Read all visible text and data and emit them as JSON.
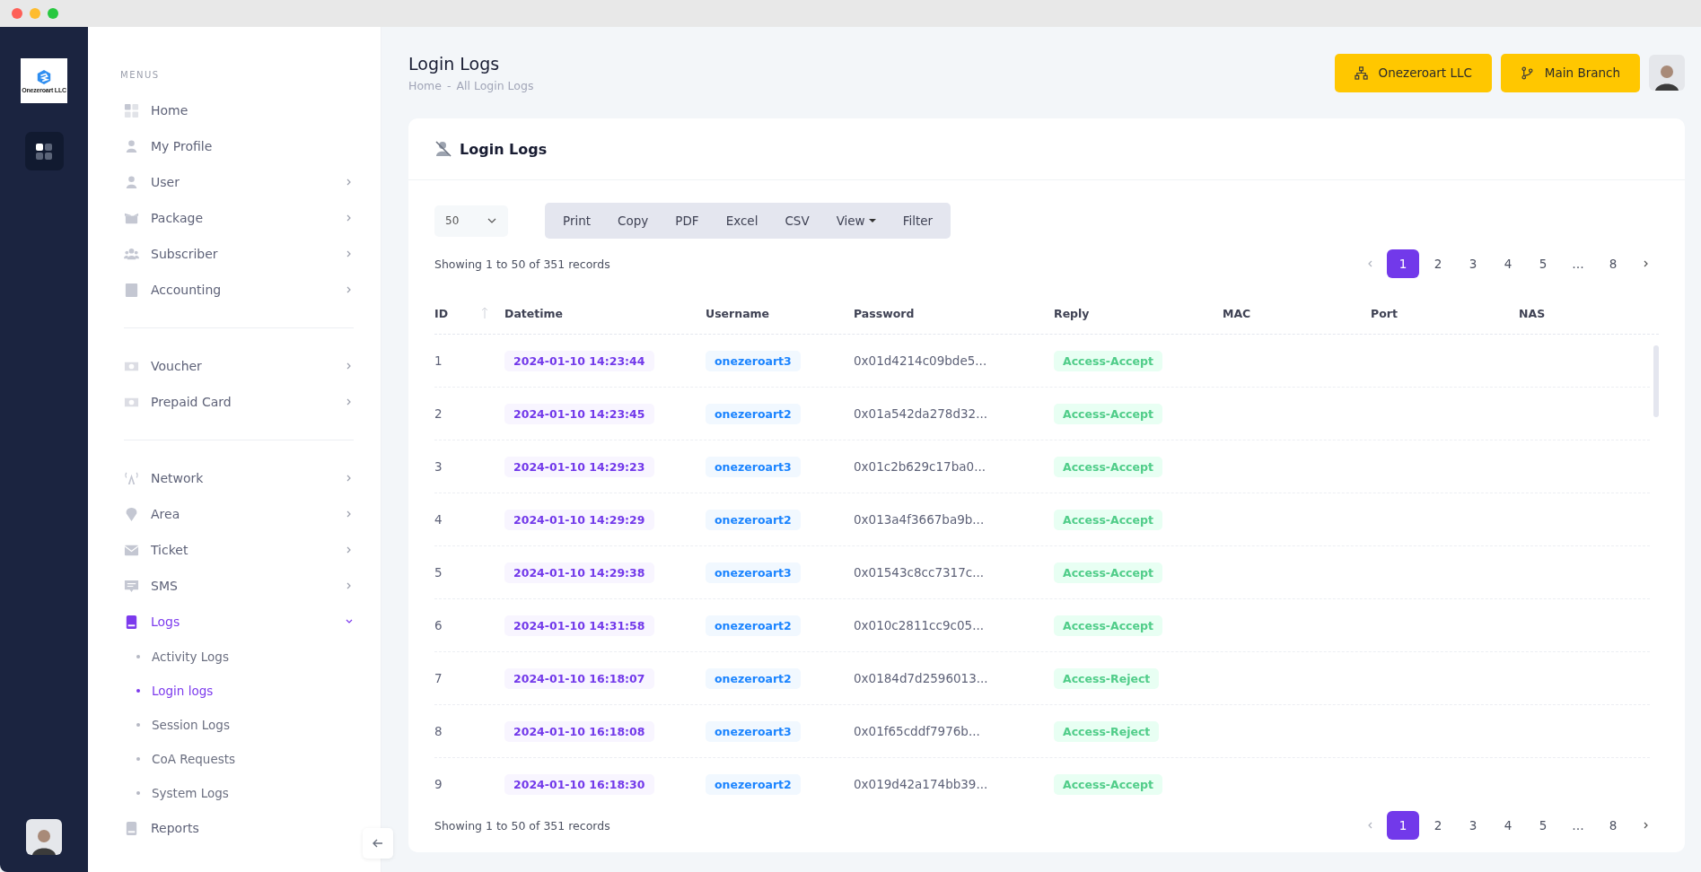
{
  "logo_text": "Onezeroart LLC",
  "sidebar": {
    "sections": [
      {
        "title": "MENUS",
        "items": [
          {
            "label": "Home",
            "kind": "link",
            "selected": false
          },
          {
            "label": "My Profile",
            "kind": "link",
            "selected": false
          },
          {
            "label": "User",
            "kind": "group",
            "selected": false,
            "expanded": false
          },
          {
            "label": "Package",
            "kind": "group",
            "selected": false,
            "expanded": false
          },
          {
            "label": "Subscriber",
            "kind": "group",
            "selected": false,
            "expanded": false
          },
          {
            "label": "Accounting",
            "kind": "group",
            "selected": false,
            "expanded": false
          }
        ]
      },
      {
        "items": [
          {
            "label": "Voucher",
            "kind": "group",
            "selected": false,
            "expanded": false
          },
          {
            "label": "Prepaid Card",
            "kind": "group",
            "selected": false,
            "expanded": false
          }
        ]
      },
      {
        "items": [
          {
            "label": "Network",
            "kind": "group",
            "selected": false,
            "expanded": false
          },
          {
            "label": "Area",
            "kind": "group",
            "selected": false,
            "expanded": false
          },
          {
            "label": "Ticket",
            "kind": "group",
            "selected": false,
            "expanded": false
          },
          {
            "label": "SMS",
            "kind": "group",
            "selected": false,
            "expanded": false
          },
          {
            "label": "Logs",
            "kind": "group",
            "selected": true,
            "expanded": true,
            "children": [
              {
                "label": "Activity Logs",
                "selected": false
              },
              {
                "label": "Login logs",
                "selected": true
              },
              {
                "label": "Session Logs",
                "selected": false
              },
              {
                "label": "CoA Requests",
                "selected": false
              },
              {
                "label": "System Logs",
                "selected": false
              }
            ]
          },
          {
            "label": "Reports",
            "kind": "link",
            "selected": false
          }
        ]
      }
    ]
  },
  "header": {
    "title": "Login Logs",
    "breadcrumb": [
      "Home",
      "All Login Logs"
    ],
    "breadcrumb_separator": "-",
    "buttons": [
      "Onezeroart LLC",
      "Main Branch"
    ]
  },
  "card": {
    "title": "Login Logs",
    "page_size": "50",
    "toolbar": [
      {
        "label": "Print",
        "kind": "button"
      },
      {
        "label": "Copy",
        "kind": "button"
      },
      {
        "label": "PDF",
        "kind": "button"
      },
      {
        "label": "Excel",
        "kind": "button"
      },
      {
        "label": "CSV",
        "kind": "button"
      },
      {
        "label": "View",
        "kind": "dropdown"
      },
      {
        "label": "Filter",
        "kind": "button"
      }
    ],
    "info_top": "Showing 1 to 50 of 351 records",
    "info_bottom": "Showing 1 to 50 of 351 records",
    "pages_top": [
      {
        "label": "1",
        "selected": true
      },
      {
        "label": "2",
        "selected": false
      },
      {
        "label": "3",
        "selected": false
      },
      {
        "label": "4",
        "selected": false
      },
      {
        "label": "5",
        "selected": false
      },
      {
        "label": "…",
        "selected": false
      },
      {
        "label": "8",
        "selected": false
      }
    ],
    "pages_bottom": [
      {
        "label": "1",
        "selected": true
      },
      {
        "label": "2",
        "selected": false
      },
      {
        "label": "3",
        "selected": false
      },
      {
        "label": "4",
        "selected": false
      },
      {
        "label": "5",
        "selected": false
      },
      {
        "label": "…",
        "selected": false
      },
      {
        "label": "8",
        "selected": false
      }
    ],
    "table": {
      "columns": [
        "ID",
        "Datetime",
        "Username",
        "Password",
        "Reply",
        "MAC",
        "Port",
        "NAS"
      ],
      "rows": [
        {
          "id": "1",
          "datetime": "2024-01-10 14:23:44",
          "username": "onezeroart3",
          "password": "0x01d4214c09bde5...",
          "reply": "Access-Accept"
        },
        {
          "id": "2",
          "datetime": "2024-01-10 14:23:45",
          "username": "onezeroart2",
          "password": "0x01a542da278d32...",
          "reply": "Access-Accept"
        },
        {
          "id": "3",
          "datetime": "2024-01-10 14:29:23",
          "username": "onezeroart3",
          "password": "0x01c2b629c17ba0...",
          "reply": "Access-Accept"
        },
        {
          "id": "4",
          "datetime": "2024-01-10 14:29:29",
          "username": "onezeroart2",
          "password": "0x013a4f3667ba9b...",
          "reply": "Access-Accept"
        },
        {
          "id": "5",
          "datetime": "2024-01-10 14:29:38",
          "username": "onezeroart3",
          "password": "0x01543c8cc7317c...",
          "reply": "Access-Accept"
        },
        {
          "id": "6",
          "datetime": "2024-01-10 14:31:58",
          "username": "onezeroart2",
          "password": "0x010c2811cc9c05...",
          "reply": "Access-Accept"
        },
        {
          "id": "7",
          "datetime": "2024-01-10 16:18:07",
          "username": "onezeroart2",
          "password": "0x0184d7d2596013...",
          "reply": "Access-Reject"
        },
        {
          "id": "8",
          "datetime": "2024-01-10 16:18:08",
          "username": "onezeroart3",
          "password": "0x01f65cddf7976b...",
          "reply": "Access-Reject"
        },
        {
          "id": "9",
          "datetime": "2024-01-10 16:18:30",
          "username": "onezeroart2",
          "password": "0x019d42a174bb39...",
          "reply": "Access-Accept"
        }
      ]
    }
  }
}
